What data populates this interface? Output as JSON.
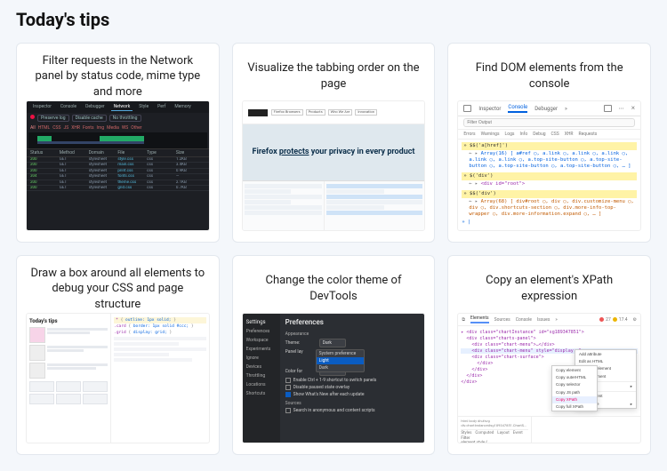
{
  "page": {
    "title": "Today's tips"
  },
  "cards": [
    {
      "title": "Filter requests in the Network panel by status code, mime type and more",
      "thumb": {
        "tabs": [
          "Inspector",
          "Console",
          "Debugger",
          "Network",
          "Style",
          "Perf",
          "Memory"
        ],
        "toolbar": [
          "Preserve log",
          "Disable cache",
          "No throttling"
        ],
        "filters": [
          "All",
          "HTML",
          "CSS",
          "JS",
          "XHR",
          "Fonts",
          "Img",
          "Media",
          "WS",
          "Other"
        ],
        "columns": [
          "Status",
          "Method",
          "Domain",
          "File",
          "Type",
          "Size"
        ],
        "rows": [
          [
            "200",
            "GET",
            "stylesheet",
            "style.css",
            "css",
            "1.2KB"
          ],
          [
            "200",
            "GET",
            "stylesheet",
            "main.css",
            "css",
            "3.4KB"
          ],
          [
            "200",
            "GET",
            "stylesheet",
            "print.css",
            "css",
            "0.9KB"
          ],
          [
            "304",
            "GET",
            "stylesheet",
            "fonts.css",
            "css",
            "—"
          ],
          [
            "200",
            "GET",
            "stylesheet",
            "theme.css",
            "css",
            "2.1KB"
          ],
          [
            "200",
            "GET",
            "stylesheet",
            "grid.css",
            "css",
            "0.7KB"
          ]
        ]
      }
    },
    {
      "title": "Visualize the tabbing order on the page",
      "thumb": {
        "nav": [
          "Firefox Browsers",
          "Products",
          "Who We Are",
          "Innovation"
        ],
        "hero_pre": "Firefox ",
        "hero_bold": "protects",
        "hero_post": " your privacy in every product"
      }
    },
    {
      "title": "Find DOM elements from the console",
      "thumb": {
        "tabs": {
          "inspector": "Inspector",
          "console": "Console",
          "debugger": "Debugger"
        },
        "filter_ph": "Filter Output",
        "cats": [
          "Errors",
          "Warnings",
          "Logs",
          "Info",
          "Debug",
          "CSS",
          "XHR",
          "Requests"
        ],
        "cmd1": "$$('a[href]')",
        "out1": "Array(16) [ a#ref ◯, a.link ◯, a.link ◯, a.link ◯, a.link ◯, a.link ◯, a.top-site-button ◯, a.top-site-button ◯, a.top-site-button ◯, a.top-site-button ◯, … ]",
        "cmd2": "$('div')",
        "out2": "<div id=\"root\">",
        "cmd3": "$$('div')",
        "out3": "Array(68) [ div#root ◯, div ◯, div.customize-menu ◯, div ◯, div.shortcuts-section ◯, div.more-info-top-wrapper ◯, div.more-information.expand ◯, … ]"
      }
    },
    {
      "title": "Draw a box around all elements to debug your CSS and page structure",
      "thumb": {
        "left_title": "Today's tips",
        "css": [
          {
            "sel": "*",
            "body": "outline: 1px solid;"
          },
          {
            "sel": ".card",
            "body": "border: 1px solid #ccc;"
          },
          {
            "sel": ".grid",
            "body": "display: grid;"
          }
        ]
      }
    },
    {
      "title": "Change the color theme of DevTools",
      "thumb": {
        "heading": "Preferences",
        "side": [
          "Preferences",
          "Workspace",
          "Experiments",
          "Ignore",
          "Devices",
          "Throttling",
          "Locations",
          "Shortcuts"
        ],
        "section": "Appearance",
        "rows": {
          "theme_label": "Theme:",
          "theme_value": "Dark",
          "panel_label": "Panel lay",
          "color_label": "Color for"
        },
        "dropdown": [
          "System preference",
          "Light",
          "Dark"
        ],
        "checks": [
          {
            "on": false,
            "label": "Enable Ctrl + 1-9 shortcut to switch panels"
          },
          {
            "on": false,
            "label": "Disable paused state overlay"
          },
          {
            "on": true,
            "label": "Show What's New after each update"
          }
        ],
        "sources": {
          "label": "Sources",
          "chk": "Search in anonymous and content scripts"
        }
      }
    },
    {
      "title": "Copy an element's XPath expression",
      "thumb": {
        "tabs": [
          "Elements",
          "Sources",
          "Console",
          "Issues"
        ],
        "warn": {
          "err": "27",
          "wn": "17.4"
        },
        "dom": [
          "<div class=\"chartInstance\" id=\"sg189347851\">",
          "  <div class=\"charts-panel\">",
          "    <div class=\"chart-menu\">…</div>",
          "    <div class=\"chart-menu\" style=\"display:…\">",
          "    <div class=\"chart-surface\">",
          "      </div>",
          "    </div>",
          "  </div>",
          "</div>"
        ],
        "ctx": [
          "Add attribute",
          "Edit as HTML",
          "Duplicate element",
          "Delete element",
          "Copy",
          "Hide element",
          "Force state"
        ],
        "ctx2": [
          "Copy element",
          "Copy outerHTML",
          "Copy selector",
          "Copy JS path",
          "Copy XPath",
          "Copy full XPath"
        ],
        "breadcrumb": "html body div#svg div.chartInstance#sg189347851.ChartS…",
        "styles_tabs": [
          "Styles",
          "Computed",
          "Layout",
          "Event"
        ],
        "filter": "Filter",
        "rule": "element.style {"
      }
    }
  ]
}
